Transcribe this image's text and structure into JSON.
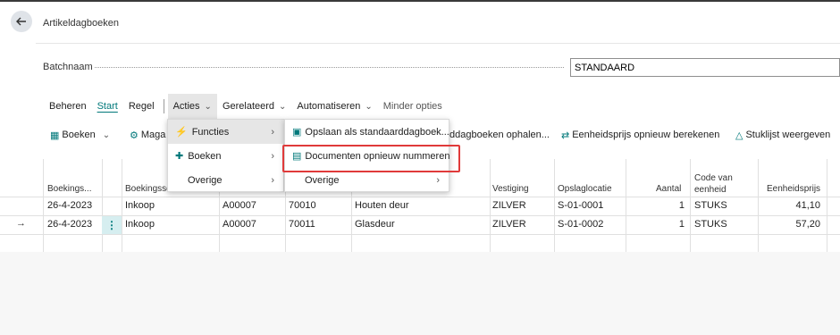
{
  "page": {
    "title": "Artikeldagboeken",
    "back_icon": "arrow-left-icon"
  },
  "batch": {
    "label": "Batchnaam",
    "value": "STANDAARD"
  },
  "menubar": {
    "items": [
      "Beheren",
      "Start",
      "Regel",
      "Acties",
      "Gerelateerd",
      "Automatiseren",
      "Minder opties"
    ]
  },
  "toolbar": {
    "boeken": "Boeken",
    "maga": "Maga",
    "ophalen": "ddagboeken ophalen...",
    "eenheidsprijs": "Eenheidsprijs opnieuw berekenen",
    "stuklijst": "Stuklijst weergeven"
  },
  "acties_menu": {
    "items": [
      "Functies",
      "Boeken",
      "Overige"
    ]
  },
  "functies_menu": {
    "items": [
      "Opslaan als standaarddagboek...",
      "Documenten opnieuw nummeren",
      "Overige"
    ]
  },
  "grid": {
    "headers": {
      "boekingsdatum": "Boekings...",
      "boekingssoort": "Boekingsso",
      "vestiging": "Vestiging",
      "opslaglocatie": "Opslaglocatie",
      "aantal": "Aantal",
      "code_eenheid_1": "Code van",
      "code_eenheid_2": "eenheid",
      "eenheidsprijs": "Eenheidsprijs"
    },
    "rows": [
      {
        "date": "26-4-2023",
        "type": "Inkoop",
        "doc": "A00007",
        "item": "70010",
        "desc": "Houten deur",
        "location": "ZILVER",
        "bin": "S-01-0001",
        "qty": "1",
        "uom": "STUKS",
        "price": "41,10"
      },
      {
        "date": "26-4-2023",
        "type": "Inkoop",
        "doc": "A00007",
        "item": "70011",
        "desc": "Glasdeur",
        "location": "ZILVER",
        "bin": "S-01-0002",
        "qty": "1",
        "uom": "STUKS",
        "price": "57,20"
      }
    ]
  },
  "colors": {
    "accent": "#00787a",
    "highlight": "#e03a3a"
  }
}
